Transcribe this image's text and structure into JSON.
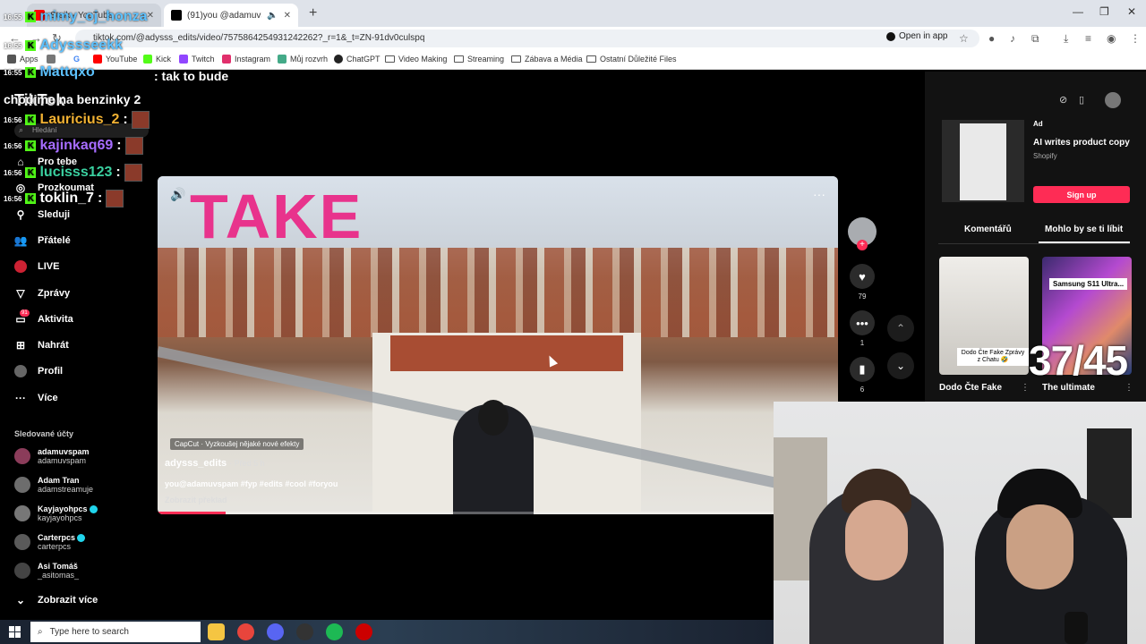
{
  "browser": {
    "tabs": [
      {
        "title": "Steik - YouTube",
        "favicon_color": "#ff0000"
      },
      {
        "title": "(91)you @adamuvspam #fy",
        "favicon_color": "#000000"
      }
    ],
    "url": "tiktok.com/@adysss_edits/video/7575864254931242262?_r=1&_t=ZN-91dv0culspq",
    "open_in_app": "Open in app",
    "bookmarks": [
      {
        "label": "Apps",
        "icon": "apps-grid-icon"
      },
      {
        "label": "YouTube",
        "icon": "youtube-icon",
        "color": "#ff0000"
      },
      {
        "label": "Kick",
        "icon": "kick-icon",
        "color": "#53fc18"
      },
      {
        "label": "Twitch",
        "icon": "twitch-icon",
        "color": "#9146ff"
      },
      {
        "label": "Instagram",
        "icon": "instagram-icon",
        "color": "#e1306c"
      },
      {
        "label": "Můj rozvrh",
        "icon": "schedule-icon",
        "color": "#4a8"
      },
      {
        "label": "ChatGPT",
        "icon": "chatgpt-icon",
        "color": "#222"
      },
      {
        "label": "Video Making",
        "icon": "folder-icon"
      },
      {
        "label": "Streaming",
        "icon": "folder-icon"
      },
      {
        "label": "Zábava a Média",
        "icon": "folder-icon"
      },
      {
        "label": "Ostatní Důležité Files",
        "icon": "folder-icon"
      }
    ]
  },
  "chat": {
    "messages": [
      {
        "time": "16:55",
        "user": "mimy_oj_honza",
        "color": "#5dc2ff"
      },
      {
        "time": "16:55",
        "user": "Adyssseekk",
        "color": "#5dc2ff"
      },
      {
        "time": "16:55",
        "user": "Mattqxo",
        "color": "#5dc2ff",
        "text": ": tak to bude chodime na benzinky 2"
      },
      {
        "time": "16:56",
        "user": "Lauricius_2",
        "color": "#f2b233",
        "text": ":"
      },
      {
        "time": "16:56",
        "user": "kajinkaq69",
        "color": "#a66cff",
        "text": ":"
      },
      {
        "time": "16:56",
        "user": "lucisss123",
        "color": "#3ad0a0",
        "text": ":"
      },
      {
        "time": "16:56",
        "user": "toklin_7",
        "color": "#ffffff",
        "text": ":"
      }
    ]
  },
  "tiktok": {
    "logo": "TikTok",
    "search_placeholder": "Hledání",
    "nav": [
      {
        "label": "Pro tebe",
        "icon": "home-icon"
      },
      {
        "label": "Prozkoumat",
        "icon": "compass-icon"
      },
      {
        "label": "Sleduji",
        "icon": "following-icon"
      },
      {
        "label": "Přátelé",
        "icon": "friends-icon"
      },
      {
        "label": "LIVE",
        "icon": "live-icon"
      },
      {
        "label": "Zprávy",
        "icon": "messages-icon"
      },
      {
        "label": "Aktivita",
        "icon": "activity-icon",
        "badge": "91"
      },
      {
        "label": "Nahrát",
        "icon": "upload-icon"
      },
      {
        "label": "Profil",
        "icon": "profile-icon"
      },
      {
        "label": "Více",
        "icon": "more-icon"
      }
    ],
    "following_header": "Sledované účty",
    "following": [
      {
        "name": "adamuvspam",
        "handle": "adamuvspam",
        "verified": false
      },
      {
        "name": "Adam Tran",
        "handle": "adamstreamuje",
        "verified": false
      },
      {
        "name": "Kayjayohpcs",
        "handle": "kayjayohpcs",
        "verified": true
      },
      {
        "name": "Carterpcs",
        "handle": "carterpcs",
        "verified": true
      },
      {
        "name": "Asi Tomáš",
        "handle": "_asitomas_",
        "verified": false
      }
    ],
    "show_more": "Zobrazit více"
  },
  "video": {
    "overlay_text": "TAKE",
    "capcut": "CapCut · Vyzkoušej nějaké nové efekty",
    "author": "adysss_edits",
    "posted": "· Před 5 h",
    "description": "you@adamuvspam #fyp #edits #cool #foryou",
    "translate": "Zobrazit překlad",
    "progress_fraction": 0.1,
    "likes": "79",
    "comments": "1",
    "saves": "6"
  },
  "right_panel": {
    "ad_label": "Ad",
    "ad_title": "AI writes product copy",
    "ad_sponsor": "Shopify",
    "signup": "Sign up",
    "tab_comments": "Komentářů",
    "tab_suggested": "Mohlo by se ti líbit",
    "cards": [
      {
        "caption": "Dodo Čte Fake Zprávy z Chatu 🤣",
        "title": "Dodo Čte Fake"
      },
      {
        "caption": "Samsung S11 Ultra...",
        "title": "The ultimate"
      }
    ],
    "counter": "37/45"
  },
  "taskbar": {
    "search_placeholder": "Type here to search",
    "apps": [
      {
        "name": "file-explorer-icon",
        "color": "#f5c542"
      },
      {
        "name": "chrome-icon",
        "color": "#e8453c"
      },
      {
        "name": "discord-icon",
        "color": "#5865f2"
      },
      {
        "name": "obs-icon",
        "color": "#333"
      },
      {
        "name": "spotify-icon",
        "color": "#1db954"
      },
      {
        "name": "recorder-icon",
        "color": "#c00"
      }
    ]
  }
}
